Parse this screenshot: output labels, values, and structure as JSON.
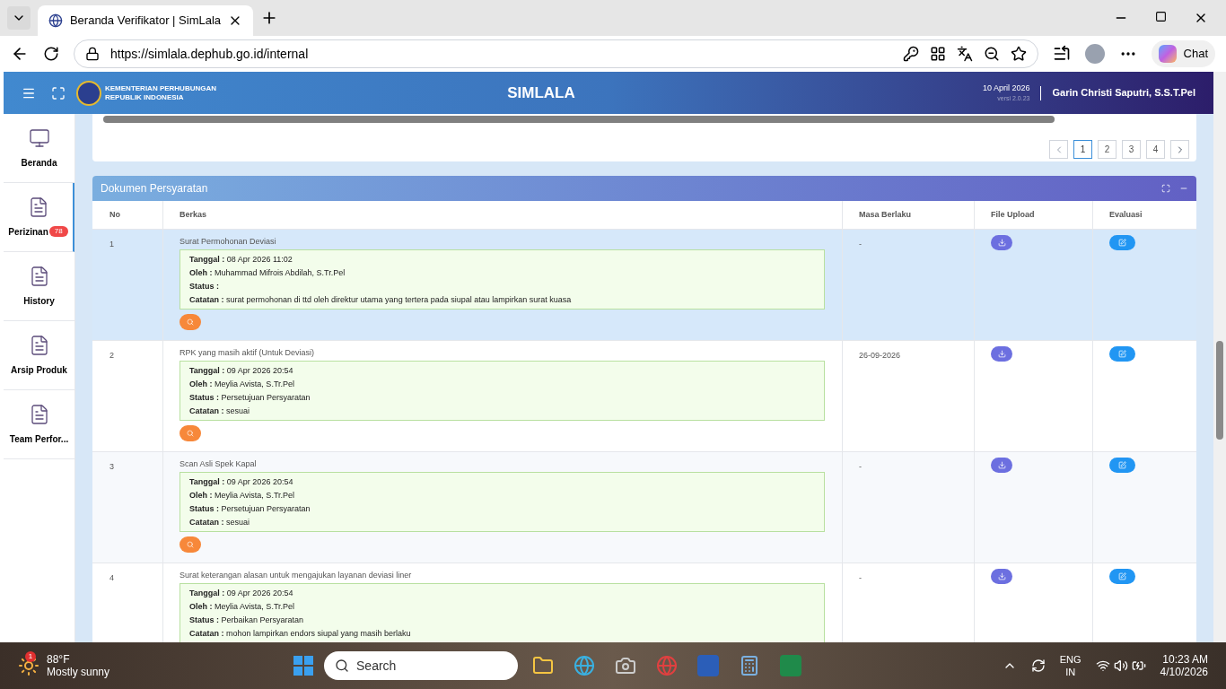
{
  "browser": {
    "tab_title": "Beranda Verifikator | SimLala",
    "url": "https://simlala.dephub.go.id/internal",
    "chat_label": "Chat"
  },
  "header": {
    "org_lines": [
      "KEMENTERIAN PERHUBUNGAN",
      "REPUBLIK INDONESIA"
    ],
    "title": "SIMLALA",
    "date": "10 April 2026",
    "version": "versi 2.0.23",
    "user": "Garin Christi Saputri, S.S.T.Pel"
  },
  "sidebar": {
    "items": [
      {
        "kind": "monitor",
        "label": "Beranda",
        "selected": false
      },
      {
        "kind": "doc",
        "label": "Perizinan",
        "badge": "78",
        "selected": true
      },
      {
        "kind": "doc",
        "label": "History",
        "selected": false
      },
      {
        "kind": "doc",
        "label": "Arsip Produk",
        "selected": false
      },
      {
        "kind": "doc",
        "label": "Team Perfor...",
        "selected": false
      }
    ]
  },
  "pagination": {
    "pages": [
      {
        "label": "1",
        "selected": true
      },
      {
        "label": "2",
        "selected": false
      },
      {
        "label": "3",
        "selected": false
      },
      {
        "label": "4",
        "selected": false
      }
    ]
  },
  "panel": {
    "title": "Dokumen Persyaratan",
    "columns": [
      "No",
      "Berkas",
      "Masa Berlaku",
      "File Upload",
      "Evaluasi"
    ],
    "rows": [
      {
        "no": "1",
        "berkas": "Surat Permohonan Deviasi",
        "selected": true,
        "details": [
          {
            "label": "Tanggal :",
            "value": "08 Apr 2026 11:02"
          },
          {
            "label": "Oleh :",
            "value": "Muhammad Mifrois Abdilah, S.Tr.Pel"
          },
          {
            "label": "Status :"
          },
          {
            "label": "Catatan :",
            "value": "surat permohonan di ttd oleh direktur utama yang tertera pada siupal atau lampirkan surat kuasa"
          }
        ],
        "masa_berlaku": "-"
      },
      {
        "no": "2",
        "berkas": "RPK yang masih aktif (Untuk Deviasi)",
        "selected": false,
        "details": [
          {
            "label": "Tanggal :",
            "value": "09 Apr 2026 20:54"
          },
          {
            "label": "Oleh :",
            "value": "Meylia Avista, S.Tr.Pel"
          },
          {
            "label": "Status :",
            "value": "Persetujuan Persyaratan"
          },
          {
            "label": "Catatan :",
            "value": "sesuai"
          }
        ],
        "masa_berlaku": "26-09-2026"
      },
      {
        "no": "3",
        "berkas": "Scan Asli Spek Kapal",
        "selected": false,
        "details": [
          {
            "label": "Tanggal :",
            "value": "09 Apr 2026 20:54"
          },
          {
            "label": "Oleh :",
            "value": "Meylia Avista, S.Tr.Pel"
          },
          {
            "label": "Status :",
            "value": "Persetujuan Persyaratan"
          },
          {
            "label": "Catatan :",
            "value": "sesuai"
          }
        ],
        "masa_berlaku": "-"
      },
      {
        "no": "4",
        "berkas": "Surat keterangan alasan untuk mengajukan layanan deviasi liner",
        "selected": false,
        "details": [
          {
            "label": "Tanggal :",
            "value": "09 Apr 2026 20:54"
          },
          {
            "label": "Oleh :",
            "value": "Meylia Avista, S.Tr.Pel"
          },
          {
            "label": "Status :",
            "value": "Perbaikan Persyaratan"
          },
          {
            "label": "Catatan :",
            "value": "mohon lampirkan endors siupal yang masih berlaku"
          }
        ],
        "masa_berlaku": "-"
      }
    ]
  },
  "taskbar": {
    "weather_badge": "1",
    "temperature": "88°F",
    "condition": "Mostly sunny",
    "search_placeholder": "Search",
    "lang": [
      "ENG",
      "IN"
    ],
    "time": "10:23 AM",
    "date": "4/10/2026"
  }
}
